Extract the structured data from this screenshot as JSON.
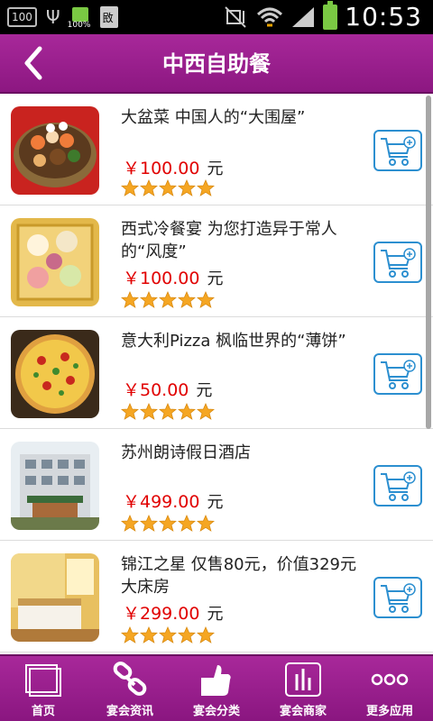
{
  "status_bar": {
    "left_badge": "100",
    "battery_small_label": "100%",
    "doc_glyph": "敃",
    "clock": "10:53"
  },
  "header": {
    "title": "中西自助餐",
    "back_icon": "chevron-left-icon"
  },
  "items": [
    {
      "title": "大盆菜 中国人的“大围屋”",
      "price": "￥100.00",
      "unit": "元",
      "rating": 5,
      "image": "seafood-pot"
    },
    {
      "title": "西式冷餐宴  为您打造异于常人的“风度”",
      "price": "￥100.00",
      "unit": "元",
      "rating": 5,
      "image": "buffet-platter"
    },
    {
      "title": "意大利Pizza  枫临世界的“薄饼”",
      "price": "￥50.00",
      "unit": "元",
      "rating": 5,
      "image": "pizza"
    },
    {
      "title": "苏州朗诗假日酒店",
      "price": "￥499.00",
      "unit": "元",
      "rating": 5,
      "image": "hotel-building"
    },
    {
      "title": "锦江之星 仅售80元，价值329元大床房",
      "price": "￥299.00",
      "unit": "元",
      "rating": 5,
      "image": "hotel-room"
    }
  ],
  "bottom_nav": [
    {
      "label": "首页",
      "icon": "home-icon"
    },
    {
      "label": "宴会资讯",
      "icon": "link-icon"
    },
    {
      "label": "宴会分类",
      "icon": "thumbs-up-icon"
    },
    {
      "label": "宴会商家",
      "icon": "bar-chart-icon"
    },
    {
      "label": "更多应用",
      "icon": "more-icon"
    }
  ],
  "colors": {
    "accent": "#9b1f8f",
    "price": "#e10000",
    "cart_border": "#2c8fd0",
    "star": "#f5a623"
  }
}
